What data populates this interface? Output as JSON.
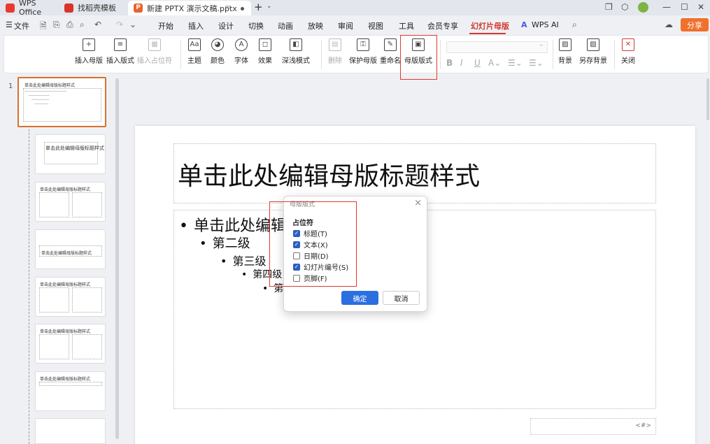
{
  "titlebar": {
    "tabs": [
      {
        "label": "WPS Office"
      },
      {
        "label": "找稻壳模板"
      },
      {
        "label": "新建 PPTX 演示文稿.pptx"
      }
    ],
    "add_symbol": "+"
  },
  "menubar": {
    "file_label": "文件",
    "items": [
      "开始",
      "插入",
      "设计",
      "切换",
      "动画",
      "放映",
      "审阅",
      "视图",
      "工具",
      "会员专享",
      "幻灯片母版",
      "WPS AI"
    ],
    "active": "幻灯片母版",
    "share_label": "分享"
  },
  "ribbon": {
    "buttons": [
      {
        "label": "插入母版",
        "enabled": true
      },
      {
        "label": "插入版式",
        "enabled": true
      },
      {
        "label": "插入占位符",
        "enabled": false
      },
      {
        "label": "主题",
        "enabled": true
      },
      {
        "label": "颜色",
        "enabled": true
      },
      {
        "label": "字体",
        "enabled": true
      },
      {
        "label": "效果",
        "enabled": true
      },
      {
        "label": "深浅模式",
        "enabled": true
      },
      {
        "label": "删除",
        "enabled": false
      },
      {
        "label": "保护母版",
        "enabled": true
      },
      {
        "label": "重命名",
        "enabled": true
      },
      {
        "label": "母版版式",
        "enabled": true
      },
      {
        "label": "背景",
        "enabled": true
      },
      {
        "label": "另存背景",
        "enabled": true
      },
      {
        "label": "关闭",
        "enabled": true
      }
    ],
    "highlight": "母版版式"
  },
  "thumbnails": {
    "first_number": "1",
    "titles": [
      "单击此处编辑母版标题样式",
      "单击此处编辑母版标题样式",
      "单击此处编辑母版标题样式",
      "单击此处编辑母版标题样式",
      "单击此处编辑母版标题样式",
      "单击此处编辑母版标题样式",
      "单击此处编辑母版标题样式"
    ]
  },
  "slide": {
    "title": "单击此处编辑母版标题样式",
    "levels": [
      "单击此处编辑",
      "第二级",
      "第三级",
      "第四级",
      "第"
    ],
    "number_placeholder": "<#>"
  },
  "dialog": {
    "title": "母版版式",
    "group_label": "占位符",
    "options": [
      {
        "label": "标题(T)",
        "checked": true
      },
      {
        "label": "文本(X)",
        "checked": true
      },
      {
        "label": "日期(D)",
        "checked": false
      },
      {
        "label": "幻灯片编号(S)",
        "checked": true
      },
      {
        "label": "页脚(F)",
        "checked": false
      }
    ],
    "ok_label": "确定",
    "cancel_label": "取消"
  },
  "colors": {
    "accent_red": "#d13a2f",
    "primary_blue": "#2b6fe0",
    "share_orange": "#f0702c"
  }
}
